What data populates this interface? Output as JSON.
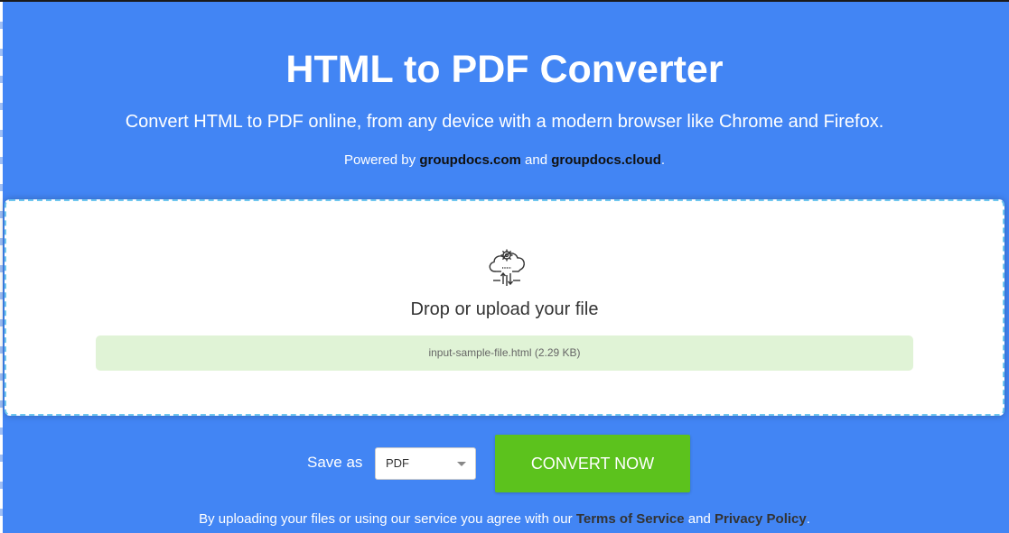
{
  "header": {
    "title": "HTML to PDF Converter",
    "subtitle": "Convert HTML to PDF online, from any device with a modern browser like Chrome and Firefox.",
    "powered_prefix": "Powered by ",
    "powered_link1": "groupdocs.com",
    "powered_and": " and ",
    "powered_link2": "groupdocs.cloud",
    "powered_suffix": "."
  },
  "upload": {
    "icon": "cloud-gear-upload-icon",
    "prompt": "Drop or upload your file",
    "file_name": "input-sample-file.html (2.29 KB)"
  },
  "controls": {
    "save_as_label": "Save as",
    "format_selected": "PDF",
    "convert_label": "CONVERT NOW"
  },
  "footer": {
    "terms_prefix": "By uploading your files or using our service you agree with our ",
    "terms_link": "Terms of Service",
    "terms_and": " and ",
    "privacy_link": "Privacy Policy",
    "terms_suffix": "."
  },
  "colors": {
    "background": "#4285f4",
    "convert_button": "#5cc21d",
    "file_chip": "#e0f3d6",
    "dropzone_border": "#6ec6ef"
  }
}
